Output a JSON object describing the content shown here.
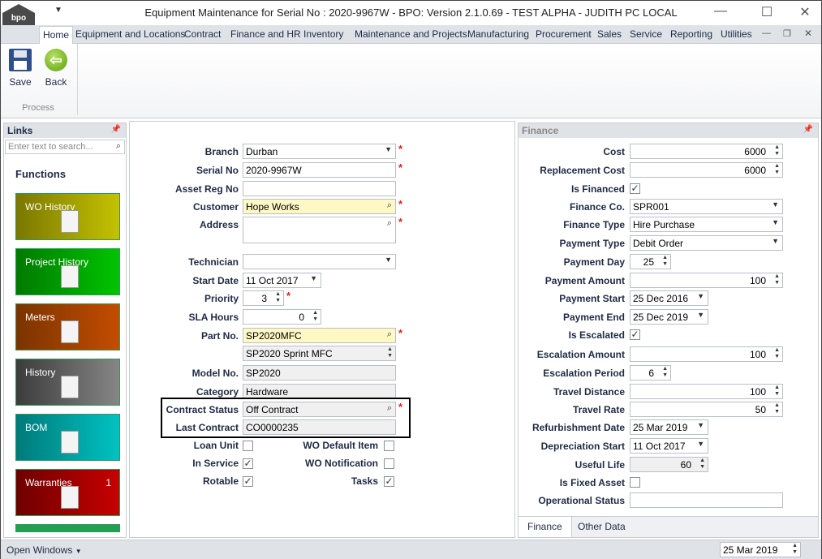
{
  "window": {
    "title": "Equipment Maintenance for Serial No : 2020-9967W - BPO: Version 2.1.0.69 - TEST ALPHA - JUDITH PC LOCAL",
    "logo": "bpo"
  },
  "ribbon": {
    "tabs": [
      "Home",
      "Equipment and Locations",
      "Contract",
      "Finance and HR",
      "Inventory",
      "Maintenance and Projects",
      "Manufacturing",
      "Procurement",
      "Sales",
      "Service",
      "Reporting",
      "Utilities"
    ],
    "save_label": "Save",
    "back_label": "Back",
    "group_label": "Process"
  },
  "links": {
    "title": "Links",
    "search_placeholder": "Enter text to search...",
    "functions_label": "Functions",
    "tiles": [
      {
        "label": "WO History",
        "icon": "clipboard-check-icon",
        "from": "#7a7800",
        "to": "#c4c200"
      },
      {
        "label": "Project History",
        "icon": "gantt-icon",
        "from": "#007a00",
        "to": "#00c400"
      },
      {
        "label": "Meters",
        "icon": "meter-icon",
        "from": "#7a3400",
        "to": "#c44c00"
      },
      {
        "label": "History",
        "icon": "history-icon",
        "from": "#3c3c3c",
        "to": "#868686"
      },
      {
        "label": "BOM",
        "icon": "notepad-icon",
        "from": "#007a7a",
        "to": "#00c2c2"
      },
      {
        "label": "Warranties",
        "icon": "wrench-document-icon",
        "from": "#6e0000",
        "to": "#c80000",
        "count": "1"
      }
    ]
  },
  "form": {
    "fields": [
      {
        "label": "Branch",
        "value": "Durban",
        "type": "dropdown",
        "required": true
      },
      {
        "label": "Serial No",
        "value": "2020-9967W",
        "type": "text",
        "required": true
      },
      {
        "label": "Asset Reg No",
        "value": "",
        "type": "text"
      },
      {
        "label": "Customer",
        "value": "Hope Works",
        "type": "search",
        "required": true,
        "yellow": true
      },
      {
        "label": "Address",
        "value": "",
        "type": "memo",
        "required": true
      },
      {
        "label": "Technician",
        "value": "",
        "type": "dropdown"
      },
      {
        "label": "Start Date",
        "value": "11 Oct 2017",
        "type": "date"
      },
      {
        "label": "Priority",
        "value": "3",
        "type": "spin",
        "required": true
      },
      {
        "label": "SLA Hours",
        "value": "0",
        "type": "spinwide"
      },
      {
        "label": "Part No.",
        "value": "SP2020MFC",
        "type": "search",
        "required": true,
        "yellow": true
      },
      {
        "label": "",
        "value": "SP2020 Sprint MFC",
        "type": "rospin"
      },
      {
        "label": "Model No.",
        "value": "SP2020",
        "type": "ro"
      },
      {
        "label": "Category",
        "value": "Hardware",
        "type": "ro"
      },
      {
        "label": "Contract Status",
        "value": "Off Contract",
        "type": "rosearch",
        "required": true
      },
      {
        "label": "Last Contract",
        "value": "CO0000235",
        "type": "ro"
      }
    ],
    "checks": [
      {
        "label": "Loan Unit",
        "checked": false
      },
      {
        "label": "WO Default Item",
        "checked": false
      },
      {
        "label": "In Service",
        "checked": true
      },
      {
        "label": "WO Notification",
        "checked": false
      },
      {
        "label": "Rotable",
        "checked": true
      },
      {
        "label": "Tasks",
        "checked": true
      }
    ]
  },
  "finance": {
    "title": "Finance",
    "fields": [
      {
        "label": "Cost",
        "value": "6000",
        "type": "num"
      },
      {
        "label": "Replacement Cost",
        "value": "6000",
        "type": "num"
      },
      {
        "label": "Is Financed",
        "checked": true,
        "type": "check"
      },
      {
        "label": "Finance Co.",
        "value": "SPR001",
        "type": "dropdown"
      },
      {
        "label": "Finance Type",
        "value": "Hire Purchase",
        "type": "dropdown"
      },
      {
        "label": "Payment Type",
        "value": "Debit Order",
        "type": "dropdown"
      },
      {
        "label": "Payment Day",
        "value": "25",
        "type": "spin"
      },
      {
        "label": "Payment Amount",
        "value": "100",
        "type": "num"
      },
      {
        "label": "Payment Start",
        "value": "25 Dec 2016",
        "type": "date"
      },
      {
        "label": "Payment End",
        "value": "25 Dec 2019",
        "type": "date"
      },
      {
        "label": "Is Escalated",
        "checked": true,
        "type": "check"
      },
      {
        "label": "Escalation Amount",
        "value": "100",
        "type": "num"
      },
      {
        "label": "Escalation Period",
        "value": "6",
        "type": "spin"
      },
      {
        "label": "Travel Distance",
        "value": "100",
        "type": "num"
      },
      {
        "label": "Travel Rate",
        "value": "50",
        "type": "num"
      },
      {
        "label": "Refurbishment Date",
        "value": "25 Mar 2019",
        "type": "date"
      },
      {
        "label": "Depreciation Start",
        "value": "11 Oct 2017",
        "type": "date"
      },
      {
        "label": "Useful Life",
        "value": "60",
        "type": "rospinnum"
      },
      {
        "label": "Is Fixed Asset",
        "checked": false,
        "type": "check"
      },
      {
        "label": "Operational Status",
        "value": "",
        "type": "text"
      }
    ],
    "tabs": [
      "Finance",
      "Other Data"
    ]
  },
  "statusbar": {
    "open_windows": "Open Windows",
    "date": "25 Mar 2019"
  }
}
